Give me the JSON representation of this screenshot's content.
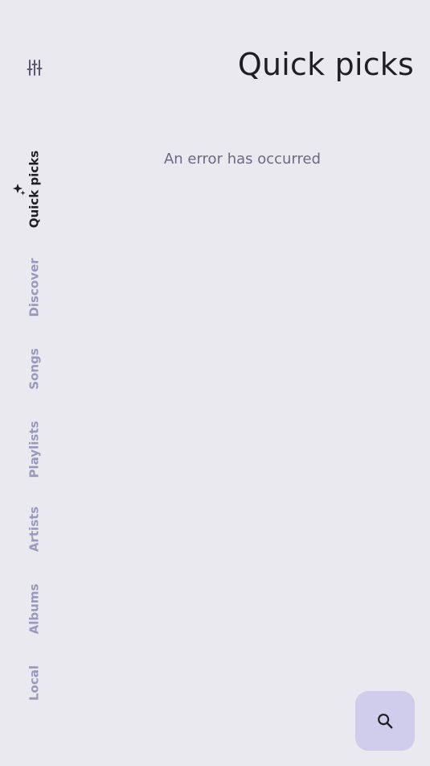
{
  "header": {
    "title": "Quick picks"
  },
  "main": {
    "message": "An error has occurred"
  },
  "nav": {
    "items": [
      {
        "label": "Quick picks",
        "active": true
      },
      {
        "label": "Discover",
        "active": false
      },
      {
        "label": "Songs",
        "active": false
      },
      {
        "label": "Playlists",
        "active": false
      },
      {
        "label": "Artists",
        "active": false
      },
      {
        "label": "Albums",
        "active": false
      },
      {
        "label": "Local",
        "active": false
      }
    ]
  },
  "icons": {
    "settings": "tune-icon",
    "active_indicator": "sparkle-icon",
    "fab": "search-icon"
  },
  "colors": {
    "background": "#e9e9ef",
    "text_primary": "#1f1f23",
    "text_secondary": "#6b6a80",
    "nav_inactive": "#9a98bc",
    "fab_background": "#cfcdeb"
  }
}
